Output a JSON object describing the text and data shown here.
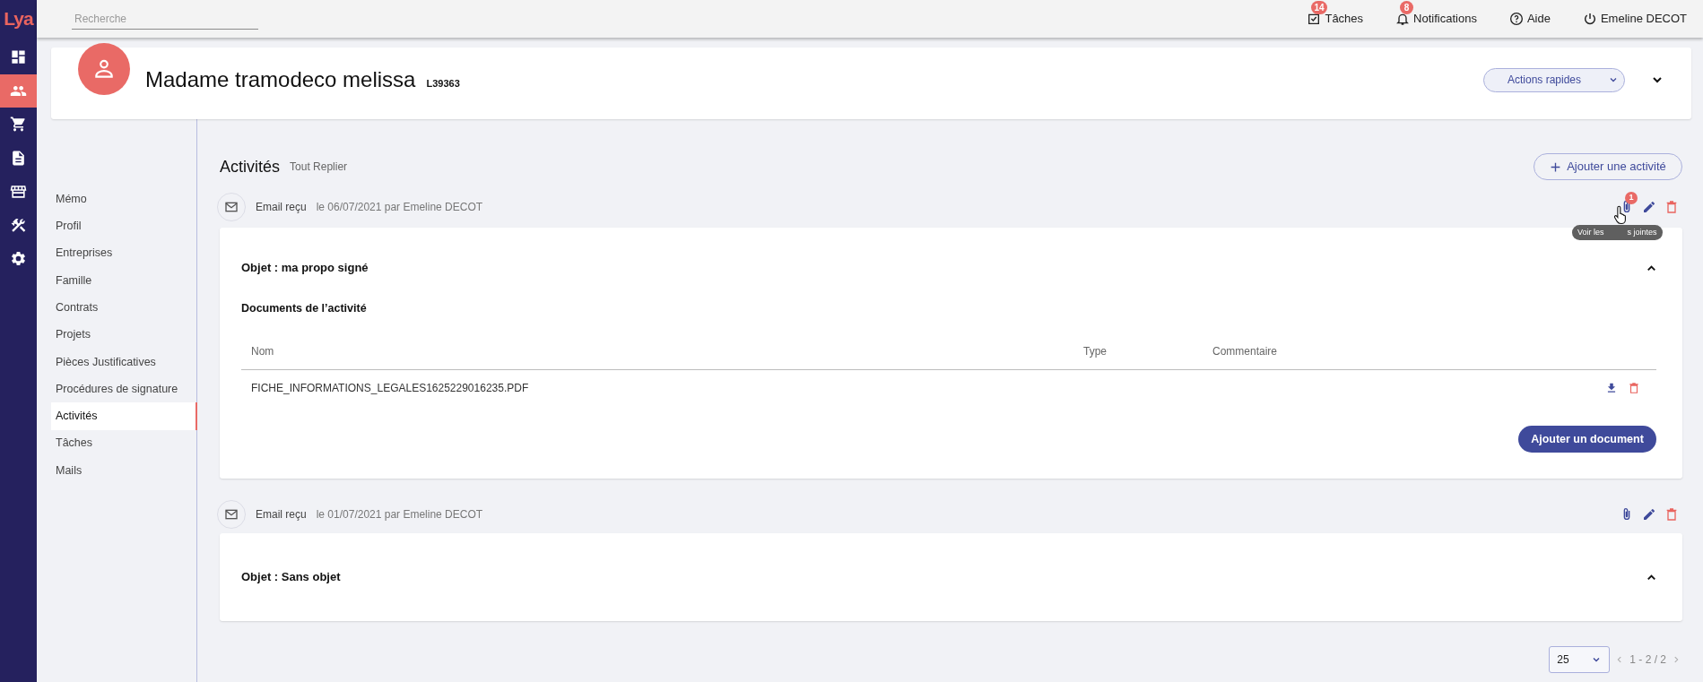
{
  "logo": {
    "text": "Lya"
  },
  "rail": {
    "items": [
      {
        "kind": "dashboard",
        "selected": false
      },
      {
        "kind": "people",
        "selected": true
      },
      {
        "kind": "cart",
        "selected": false
      },
      {
        "kind": "document",
        "selected": false
      },
      {
        "kind": "store",
        "selected": false
      },
      {
        "kind": "tools",
        "selected": false
      },
      {
        "kind": "settings",
        "selected": false
      }
    ]
  },
  "search": {
    "placeholder": "Recherche"
  },
  "topbar": {
    "items": [
      {
        "kind": "tasks",
        "label": "Tâches",
        "badge": "14"
      },
      {
        "kind": "bell",
        "label": "Notifications",
        "badge": "8"
      },
      {
        "kind": "help",
        "label": "Aide"
      },
      {
        "kind": "power",
        "label": "Emeline DECOT"
      }
    ]
  },
  "header": {
    "name": "Madame tramodeco melissa",
    "code": "L39363",
    "actions_button": "Actions rapides"
  },
  "subnav": {
    "items": [
      {
        "label": "Mémo",
        "selected": false
      },
      {
        "label": "Profil",
        "selected": false
      },
      {
        "label": "Entreprises",
        "selected": false
      },
      {
        "label": "Famille",
        "selected": false
      },
      {
        "label": "Contrats",
        "selected": false
      },
      {
        "label": "Projets",
        "selected": false
      },
      {
        "label": "Pièces Justificatives",
        "selected": false
      },
      {
        "label": "Procédures de signature",
        "selected": false
      },
      {
        "label": "Activités",
        "selected": true
      },
      {
        "label": "Tâches",
        "selected": false
      },
      {
        "label": "Mails",
        "selected": false
      }
    ]
  },
  "activities": {
    "title": "Activités",
    "collapse_all": "Tout Replier",
    "add_button": "Ajouter une activité",
    "items": [
      {
        "type": "Email reçu",
        "meta": "le 06/07/2021 par Emeline DECOT",
        "attachments_badge": "1",
        "tooltip": [
          "Voir les",
          "s jointes"
        ],
        "subject": "Objet : ma propo signé",
        "expanded": true,
        "documents": {
          "title": "Documents de l’activité",
          "columns": [
            "Nom",
            "Type",
            "Commentaire"
          ],
          "rows": [
            {
              "name": "FICHE_INFORMATIONS_LEGALES1625229016235.PDF"
            }
          ],
          "add_button": "Ajouter un document"
        }
      },
      {
        "type": "Email reçu",
        "meta": "le 01/07/2021 par Emeline DECOT",
        "subject": "Objet : Sans objet",
        "expanded": true
      }
    ]
  },
  "pagination": {
    "page_size": "25",
    "range": "1 - 2 / 2"
  }
}
